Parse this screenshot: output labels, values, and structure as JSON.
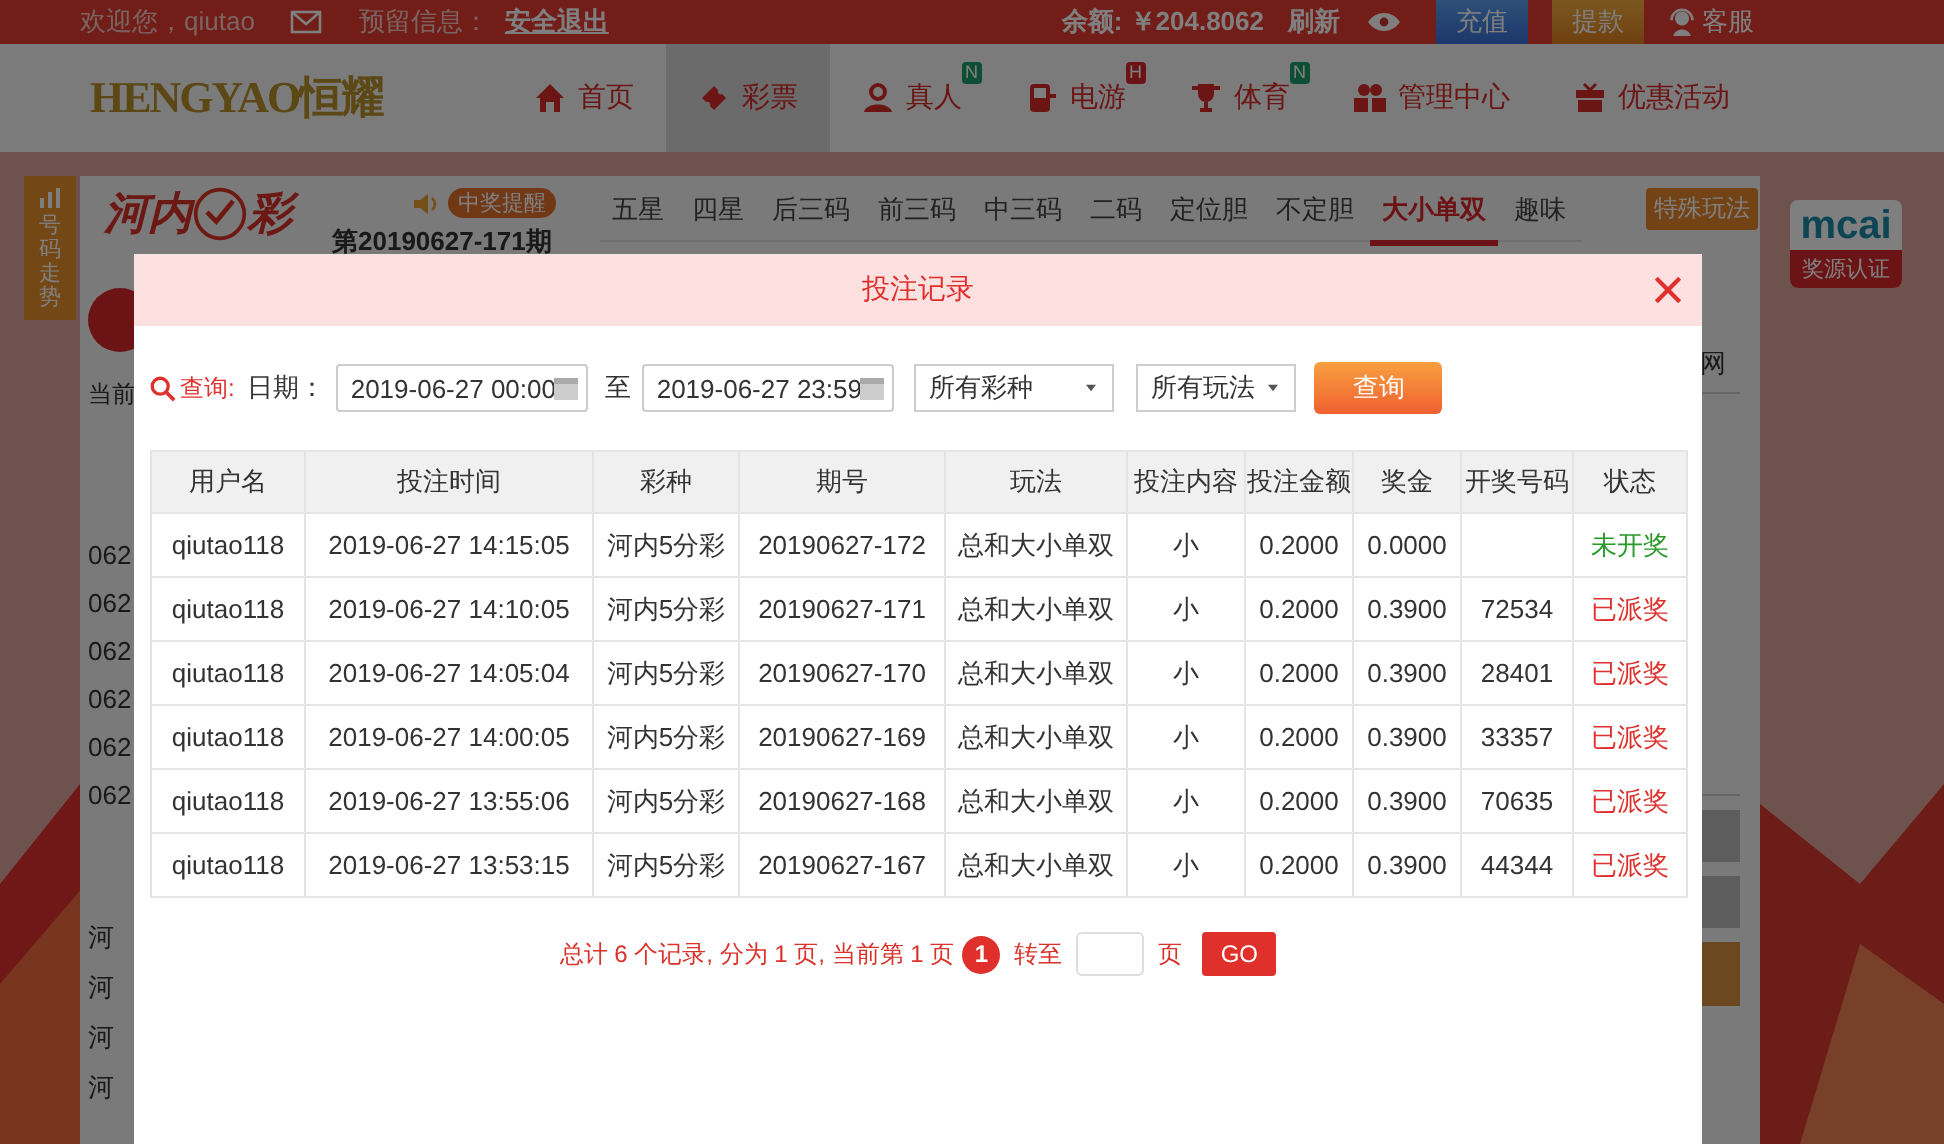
{
  "top_bar": {
    "welcome": "欢迎您，qiutao",
    "reserved_label": "预留信息：",
    "logout": "安全退出",
    "balance_label": "余额:",
    "balance": "￥204.8062",
    "refresh": "刷新",
    "buttons": [
      {
        "label": "充值",
        "kind": "deposit"
      },
      {
        "label": "提款",
        "kind": "withdraw"
      }
    ],
    "service": "客服"
  },
  "nav": {
    "logo": "HENGYAO恒耀",
    "items": [
      {
        "label": "首页",
        "selected": false
      },
      {
        "label": "彩票",
        "selected": true
      },
      {
        "label": "真人",
        "selected": false,
        "badge": {
          "text": "N",
          "kind": "new"
        }
      },
      {
        "label": "电游",
        "selected": false,
        "badge": {
          "text": "H",
          "kind": "hot"
        }
      },
      {
        "label": "体育",
        "selected": false,
        "badge": {
          "text": "N",
          "kind": "new"
        }
      },
      {
        "label": "管理中心",
        "selected": false
      },
      {
        "label": "优惠活动",
        "selected": false
      }
    ]
  },
  "side_tab": "号码走势",
  "lottery": {
    "logo_left": "河内",
    "logo_right": "彩",
    "reminder": "中奖提醒",
    "period": "第20190627-171期",
    "tabs": [
      {
        "label": "五星",
        "selected": false
      },
      {
        "label": "四星",
        "selected": false
      },
      {
        "label": "后三码",
        "selected": false
      },
      {
        "label": "前三码",
        "selected": false
      },
      {
        "label": "中三码",
        "selected": false
      },
      {
        "label": "二码",
        "selected": false
      },
      {
        "label": "定位胆",
        "selected": false
      },
      {
        "label": "不定胆",
        "selected": false
      },
      {
        "label": "大小单双",
        "selected": true
      },
      {
        "label": "趣味",
        "selected": false
      }
    ],
    "special": "特殊玩法",
    "current_label": "当前",
    "numbers": [
      "062",
      "062",
      "062",
      "062",
      "062",
      "062"
    ],
    "names": [
      "河",
      "河",
      "河",
      "河"
    ],
    "right_char": "网"
  },
  "cert": {
    "logo": "mcai",
    "label": "奖源认证"
  },
  "modal": {
    "title": "投注记录",
    "query_label": "查询:",
    "date_label": "日期：",
    "date_from": "2019-06-27 00:00",
    "to_label": "至",
    "date_to": "2019-06-27 23:59",
    "lottery_select": "所有彩种",
    "play_select": "所有玩法",
    "query_button": "查询",
    "columns": [
      "用户名",
      "投注时间",
      "彩种",
      "期号",
      "玩法",
      "投注内容",
      "投注金额",
      "奖金",
      "开奖号码",
      "状态"
    ],
    "rows": [
      {
        "cells": [
          "qiutao118",
          "2019-06-27 14:15:05",
          "河内5分彩",
          "20190627-172",
          "总和大小单双",
          "小",
          "0.2000",
          "0.0000",
          ""
        ],
        "status": {
          "text": "未开奖",
          "color": "#2a9a2a"
        }
      },
      {
        "cells": [
          "qiutao118",
          "2019-06-27 14:10:05",
          "河内5分彩",
          "20190627-171",
          "总和大小单双",
          "小",
          "0.2000",
          "0.3900",
          "72534"
        ],
        "status": {
          "text": "已派奖",
          "color": "#e0302c"
        }
      },
      {
        "cells": [
          "qiutao118",
          "2019-06-27 14:05:04",
          "河内5分彩",
          "20190627-170",
          "总和大小单双",
          "小",
          "0.2000",
          "0.3900",
          "28401"
        ],
        "status": {
          "text": "已派奖",
          "color": "#e0302c"
        }
      },
      {
        "cells": [
          "qiutao118",
          "2019-06-27 14:00:05",
          "河内5分彩",
          "20190627-169",
          "总和大小单双",
          "小",
          "0.2000",
          "0.3900",
          "33357"
        ],
        "status": {
          "text": "已派奖",
          "color": "#e0302c"
        }
      },
      {
        "cells": [
          "qiutao118",
          "2019-06-27 13:55:06",
          "河内5分彩",
          "20190627-168",
          "总和大小单双",
          "小",
          "0.2000",
          "0.3900",
          "70635"
        ],
        "status": {
          "text": "已派奖",
          "color": "#e0302c"
        }
      },
      {
        "cells": [
          "qiutao118",
          "2019-06-27 13:53:15",
          "河内5分彩",
          "20190627-167",
          "总和大小单双",
          "小",
          "0.2000",
          "0.3900",
          "44344"
        ],
        "status": {
          "text": "已派奖",
          "color": "#e0302c"
        }
      }
    ],
    "pager": {
      "summary": "总计 6 个记录, 分为 1 页, 当前第 1 页",
      "current": "1",
      "goto_label": "转至",
      "page_label": "页",
      "go": "GO"
    }
  }
}
